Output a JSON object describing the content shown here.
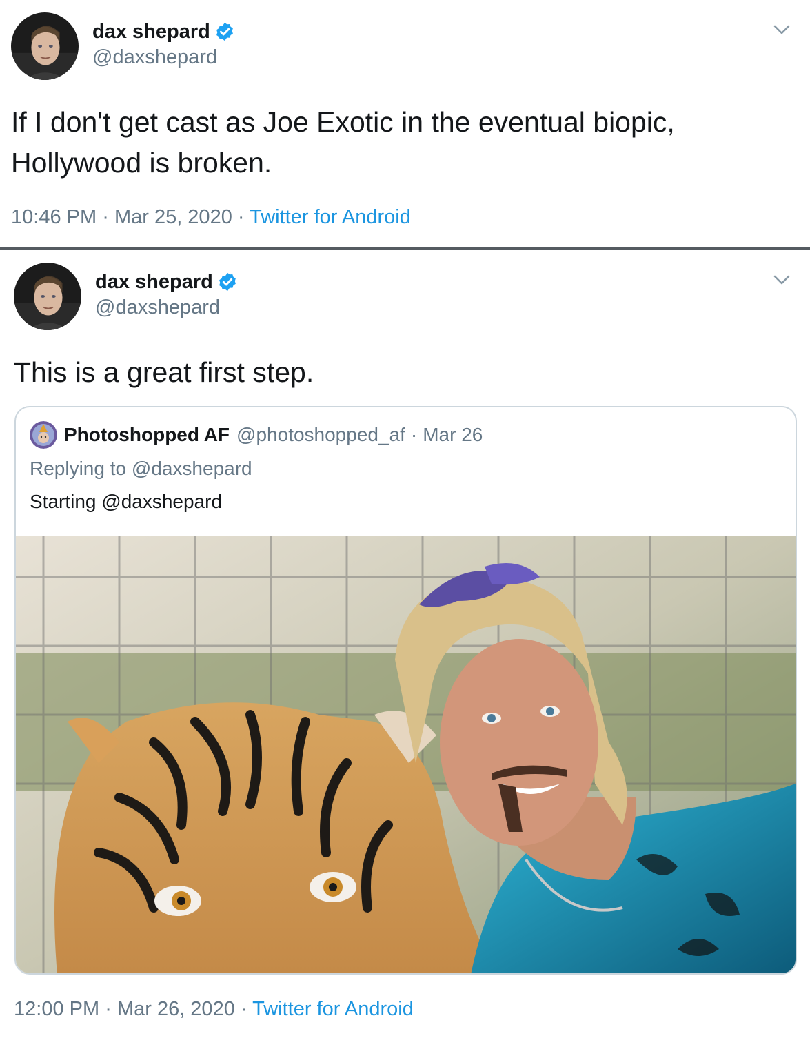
{
  "tweet1": {
    "display_name": "dax shepard",
    "handle": "@daxshepard",
    "text": "If I don't get cast as Joe Exotic in the eventual biopic, Hollywood is broken.",
    "time": "10:46 PM",
    "date": "Mar 25, 2020",
    "source": "Twitter for Android"
  },
  "tweet2": {
    "display_name": "dax shepard",
    "handle": "@daxshepard",
    "text": "This is a great first step.",
    "time": "12:00 PM",
    "date": "Mar 26, 2020",
    "source": "Twitter for Android",
    "quote": {
      "display_name": "Photoshopped AF",
      "handle": "@photoshopped_af",
      "date": "Mar 26",
      "replying_to": "Replying to @daxshepard",
      "text": "Starting @daxshepard"
    }
  },
  "separator": "·",
  "colors": {
    "verified": "#1da1f2",
    "link": "#1b95e0",
    "secondary_text": "#657786",
    "divider": "#555b61"
  },
  "icons": {
    "verified": "verified-badge-icon",
    "menu": "chevron-down-icon"
  }
}
